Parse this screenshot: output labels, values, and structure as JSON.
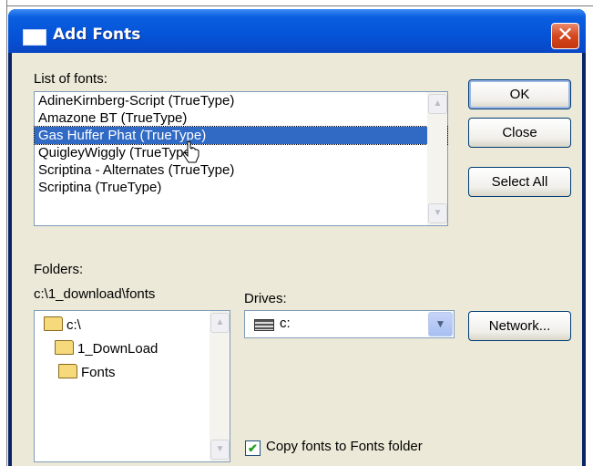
{
  "window": {
    "title": "Add Fonts",
    "close_glyph": "✕"
  },
  "fonts_list": {
    "label": "List of fonts:",
    "items": [
      "AdineKirnberg-Script (TrueType)",
      "Amazone BT (TrueType)",
      "Gas Huffer Phat (TrueType)",
      "QuigleyWiggly (TrueType)",
      "Scriptina - Alternates (TrueType)",
      "Scriptina (TrueType)"
    ],
    "selected_index": 2
  },
  "buttons": {
    "ok": "OK",
    "close": "Close",
    "select_all": "Select All",
    "network": "Network..."
  },
  "folders": {
    "label": "Folders:",
    "current_path": "c:\\1_download\\fonts",
    "items": [
      "c:\\",
      "1_DownLoad",
      "Fonts"
    ]
  },
  "drives": {
    "label": "Drives:",
    "selected": "c:"
  },
  "copy_option": {
    "label": "Copy fonts to Fonts folder",
    "checked": true
  },
  "colors": {
    "titlebar": "#0553d8",
    "selection": "#316ac5",
    "dialog_bg": "#ece9d8",
    "close_button": "#d4461f"
  }
}
